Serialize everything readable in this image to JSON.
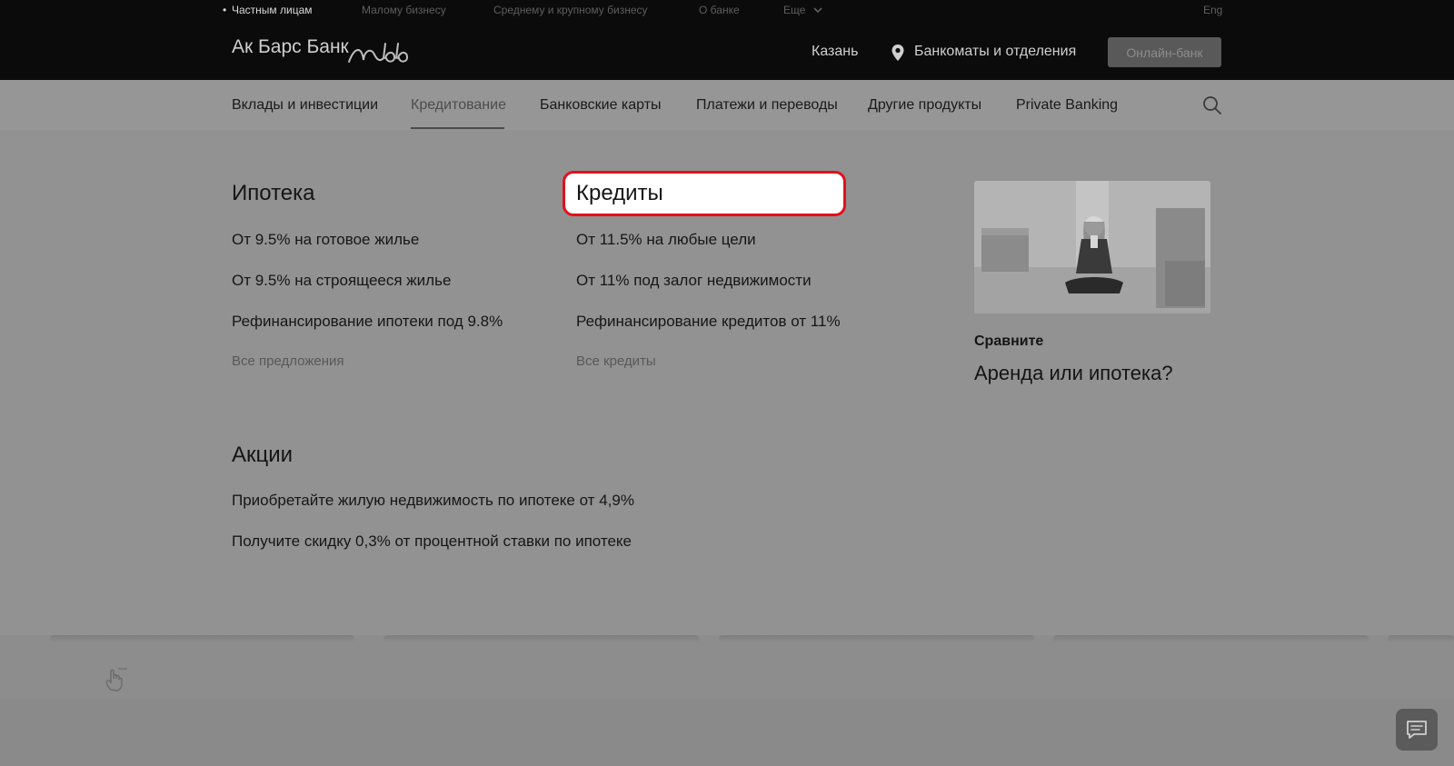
{
  "top_segments": {
    "private": "Частным лицам",
    "small_business": "Малому бизнесу",
    "medium_large_business": "Среднему и крупному бизнесу",
    "about": "О банке",
    "more": "Еще",
    "lang": "Eng"
  },
  "header": {
    "logo_text": "Ак Барс Банк",
    "city": "Казань",
    "atm_link": "Банкоматы и отделения",
    "online_bank_button": "Онлайн-банк"
  },
  "nav": {
    "items": [
      "Вклады и инвестиции",
      "Кредитование",
      "Банковские карты",
      "Платежи и переводы",
      "Другие продукты",
      "Private Banking"
    ],
    "active": "Кредитование"
  },
  "mortgage": {
    "title": "Ипотека",
    "links": [
      "От 9.5% на готовое жилье",
      "От 9.5% на строящееся жилье",
      "Рефинансирование ипотеки под 9.8%"
    ],
    "all_link": "Все предложения"
  },
  "credits": {
    "title": "Кредиты",
    "links": [
      "От 11.5% на любые цели",
      "От 11% под залог недвижимости",
      "Рефинансирование кредитов от 11%"
    ],
    "all_link": "Все кредиты"
  },
  "promotions": {
    "title": "Акции",
    "links": [
      "Приобретайте жилую недвижимость по ипотеке от 4,9%",
      "Получите скидку 0,3% от процентной ставки по ипотеке"
    ]
  },
  "promo_card": {
    "kicker": "Сравните",
    "title": "Аренда или ипотека?"
  },
  "colors": {
    "highlight_border": "#e3101a",
    "top_bar": "#0b0b0b",
    "overlay": "#929292"
  }
}
